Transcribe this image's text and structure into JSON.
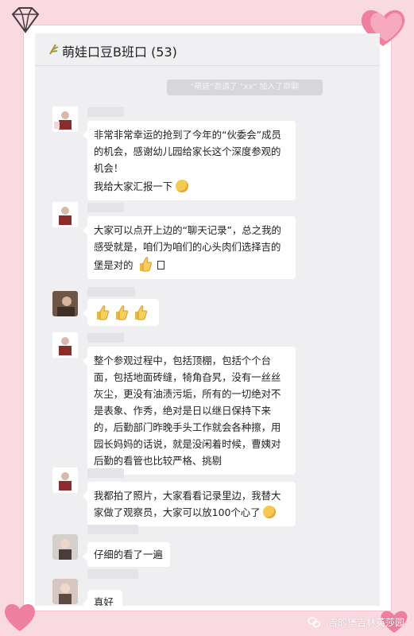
{
  "chat": {
    "title": "萌娃口豆B班口 (53)",
    "system_notice": "\"萌娃\"邀请了 \"xx\" 加入了群聊",
    "messages": [
      {
        "sender": "家长",
        "lines": [
          "非常非常幸运的抢到了今年的“伙委会”成员的机会，感谢幼儿园给家长这个深度参观的机会！"
        ],
        "line2": "我给大家汇报一下"
      },
      {
        "sender": "家长",
        "lines": [
          "大家可以点开上边的“聊天记录”，总之我的感受就是，咱们为咱们的心头肉们选择吉的堡是对的"
        ]
      },
      {
        "sender": "家长"
      },
      {
        "sender": "家长",
        "lines": [
          "整个参观过程中，包括顶棚，包括个个台面，包括地面砖缝，犄角旮旯，没有一丝丝灰尘，更没有油渍污垢，所有的一切绝对不是表象、作秀，绝对是日以继日保持下来的，后勤部门昨晚手头工作就会各种擦，用园长妈妈的话说，就是没闲着时候，曹姨对后勤的看管也比较严格、挑剔"
        ]
      },
      {
        "sender": "家长",
        "lines": [
          "我都拍了照片，大家看看记录里边，我替大家做了观察员，大家可以放100个心了"
        ]
      },
      {
        "sender": "家长",
        "lines": [
          "仔细的看了一遍"
        ]
      },
      {
        "sender": "家长",
        "lines": [
          "真好"
        ]
      }
    ]
  },
  "watermark": "吉的堡吉林英莎园",
  "colors": {
    "pink": "#f9d9e2",
    "heart": "#f08aa8",
    "chat_bg": "#efeff2"
  }
}
